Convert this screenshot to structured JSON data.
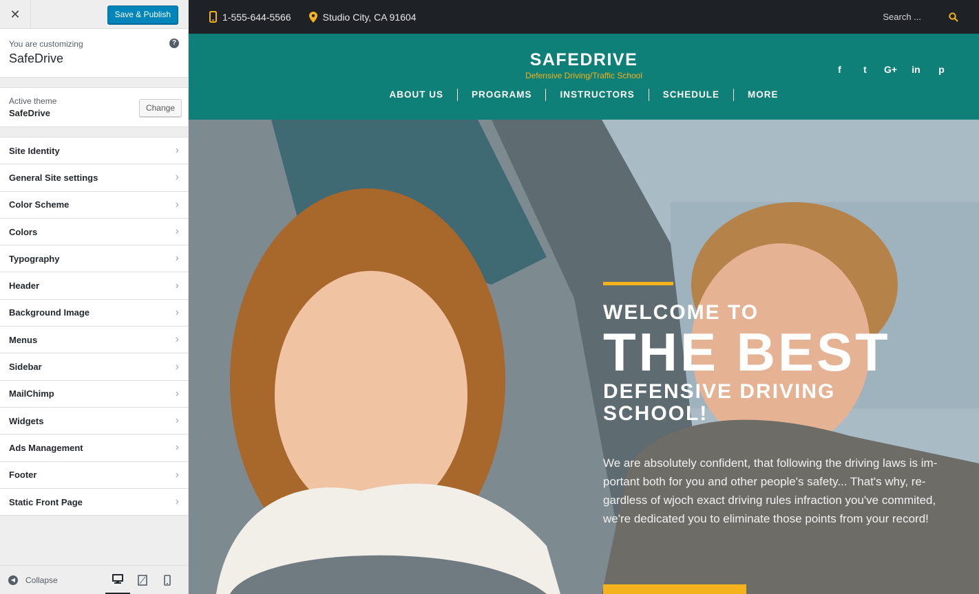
{
  "customizer": {
    "publish_label": "Save & Publish",
    "customizing_label": "You are customizing",
    "site_name": "SafeDrive",
    "active_theme_label": "Active theme",
    "active_theme_name": "SafeDrive",
    "change_label": "Change",
    "sections": [
      {
        "label": "Site Identity"
      },
      {
        "label": "General Site settings"
      },
      {
        "label": "Color Scheme"
      },
      {
        "label": "Colors"
      },
      {
        "label": "Typography"
      },
      {
        "label": "Header"
      },
      {
        "label": "Background Image"
      },
      {
        "label": "Menus"
      },
      {
        "label": "Sidebar"
      },
      {
        "label": "MailChimp"
      },
      {
        "label": "Widgets"
      },
      {
        "label": "Ads Management"
      },
      {
        "label": "Footer"
      },
      {
        "label": "Static Front Page"
      }
    ],
    "collapse_label": "Collapse",
    "devices": [
      "desktop-icon",
      "tablet-icon",
      "mobile-icon"
    ]
  },
  "preview": {
    "phone": "1-555-644-5566",
    "location": "Studio City, CA 91604",
    "search_placeholder": "Search ...",
    "site_title": "SAFEDRIVE",
    "tagline": "Defensive Driving/Traffic School",
    "social": [
      "f",
      "t",
      "G+",
      "in",
      "p"
    ],
    "nav": [
      {
        "label": "ABOUT US"
      },
      {
        "label": "PROGRAMS"
      },
      {
        "label": "INSTRUCTORS"
      },
      {
        "label": "SCHEDULE"
      },
      {
        "label": "MORE"
      }
    ],
    "hero": {
      "line1": "WELCOME TO",
      "line2": "THE BEST",
      "line3a": "DEFENSIVE DRIVING",
      "line3b": "SCHOOL!",
      "paragraph": "We are absolutely confident, that following the driving laws is im-portant both for you and other people's safety... That's why, re-gardless of wjoch exact driving rules infraction you've commited, we're dedicated you to eliminate those points from your record!"
    }
  },
  "colors": {
    "header_teal": "#0e8078",
    "accent_yellow": "#f4b21c",
    "topbar_dark": "#1e2227",
    "publish_blue": "#0085ba"
  }
}
